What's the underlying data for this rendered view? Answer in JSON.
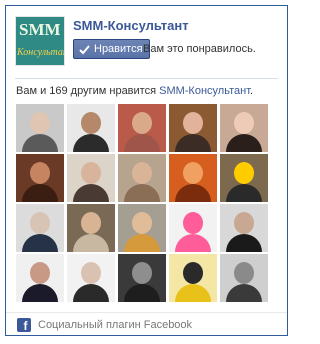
{
  "header": {
    "logo_text": "SMM",
    "logo_subtext": "Консультант",
    "page_name": "SMM-Консультант",
    "like_button_label": "Нравится",
    "liked_text": "Вам это понравилось."
  },
  "friends": {
    "prefix": "Вам и 169 другим нравится ",
    "page_link": "SMM-Консультант",
    "suffix": "."
  },
  "faces": [
    {
      "bg": "#c9c9c9",
      "skin": "#e0c6b2",
      "body": "#5a5a5a"
    },
    {
      "bg": "#e8e8e8",
      "skin": "#b48868",
      "body": "#2b2b2b"
    },
    {
      "bg": "#b95a4a",
      "skin": "#d9a98a",
      "body": "#a0554a"
    },
    {
      "bg": "#8c5a32",
      "skin": "#e2b39a",
      "body": "#3b2c25"
    },
    {
      "bg": "#c8a995",
      "skin": "#edcbb7",
      "body": "#2a1f1a"
    },
    {
      "bg": "#6b3a26",
      "skin": "#c68560",
      "body": "#3a1e12"
    },
    {
      "bg": "#dcd4c9",
      "skin": "#d8b49c",
      "body": "#4a3a34"
    },
    {
      "bg": "#b7a48e",
      "skin": "#d9b497",
      "body": "#8a6e56"
    },
    {
      "bg": "#d65e1f",
      "skin": "#f0a060",
      "body": "#7a2c0c"
    },
    {
      "bg": "#7d6a4e",
      "skin": "#ffcc00",
      "body": "#2a2a2a"
    },
    {
      "bg": "#dcdcdc",
      "skin": "#d8c4b4",
      "body": "#253248"
    },
    {
      "bg": "#7a6a55",
      "skin": "#d8b494",
      "body": "#c8b8a2"
    },
    {
      "bg": "#a59f93",
      "skin": "#e0bd98",
      "body": "#d49a3c"
    },
    {
      "bg": "#f2f2f2",
      "skin": "#ff5c9a",
      "body": "#ff5c9a"
    },
    {
      "bg": "#d8d8d8",
      "skin": "#c8a892",
      "body": "#1a1a1a"
    },
    {
      "bg": "#f0f0f0",
      "skin": "#c89a86",
      "body": "#1a1a2a"
    },
    {
      "bg": "#f2f2f2",
      "skin": "#d9c2b2",
      "body": "#2a2a2a"
    },
    {
      "bg": "#3a3a3a",
      "skin": "#8e8e8e",
      "body": "#1e1e1e"
    },
    {
      "bg": "#f4e7a6",
      "skin": "#2a2a2a",
      "body": "#e8c21a"
    },
    {
      "bg": "#cfcfcf",
      "skin": "#8a8a8a",
      "body": "#3a3a3a"
    }
  ],
  "footer": {
    "label": "Социальный плагин Facebook"
  }
}
